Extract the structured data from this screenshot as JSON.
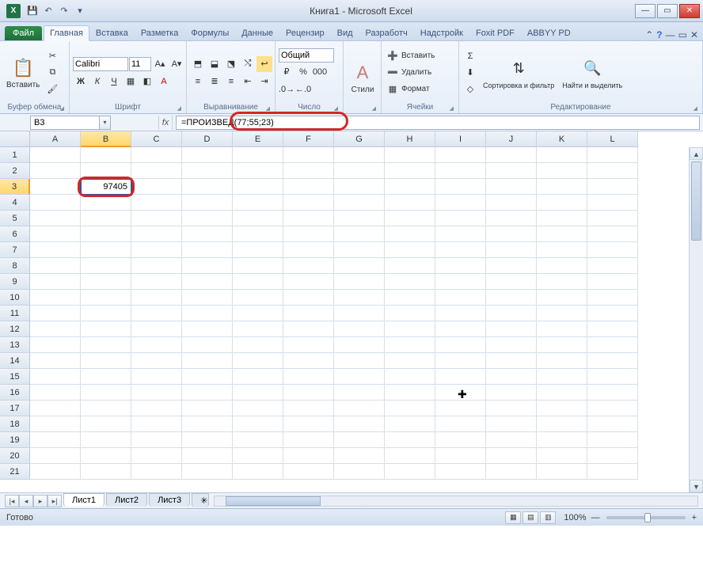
{
  "title": "Книга1 - Microsoft Excel",
  "qat": {
    "save": "💾",
    "undo": "↶",
    "redo": "↷"
  },
  "wincontrols": {
    "min": "—",
    "max": "▭",
    "close": "✕"
  },
  "tabs": {
    "file": "Файл",
    "list": [
      "Главная",
      "Вставка",
      "Разметка",
      "Формулы",
      "Данные",
      "Рецензир",
      "Вид",
      "Разработч",
      "Надстройк",
      "Foxit PDF",
      "ABBYY PD"
    ],
    "active_index": 0,
    "help": "?"
  },
  "ribbon": {
    "clipboard": {
      "paste": "Вставить",
      "label": "Буфер обмена"
    },
    "font": {
      "name": "Calibri",
      "size": "11",
      "label": "Шрифт"
    },
    "alignment": {
      "label": "Выравнивание"
    },
    "number": {
      "format": "Общий",
      "label": "Число"
    },
    "styles": {
      "btn": "Стили",
      "label": ""
    },
    "cells": {
      "insert": "Вставить",
      "delete": "Удалить",
      "format": "Формат",
      "label": "Ячейки"
    },
    "editing": {
      "sort": "Сортировка и фильтр",
      "find": "Найти и выделить",
      "label": "Редактирование"
    }
  },
  "namebox": "B3",
  "formula": "=ПРОИЗВЕД(77;55;23)",
  "columns": [
    "A",
    "B",
    "C",
    "D",
    "E",
    "F",
    "G",
    "H",
    "I",
    "J",
    "K",
    "L"
  ],
  "active_col_index": 1,
  "rows_count": 21,
  "active_row": 3,
  "cell_value": "97405",
  "sheets": {
    "tabs": [
      "Лист1",
      "Лист2",
      "Лист3"
    ],
    "active": 0
  },
  "status": {
    "ready": "Готово",
    "zoom": "100%",
    "minus": "—",
    "plus": "+"
  }
}
